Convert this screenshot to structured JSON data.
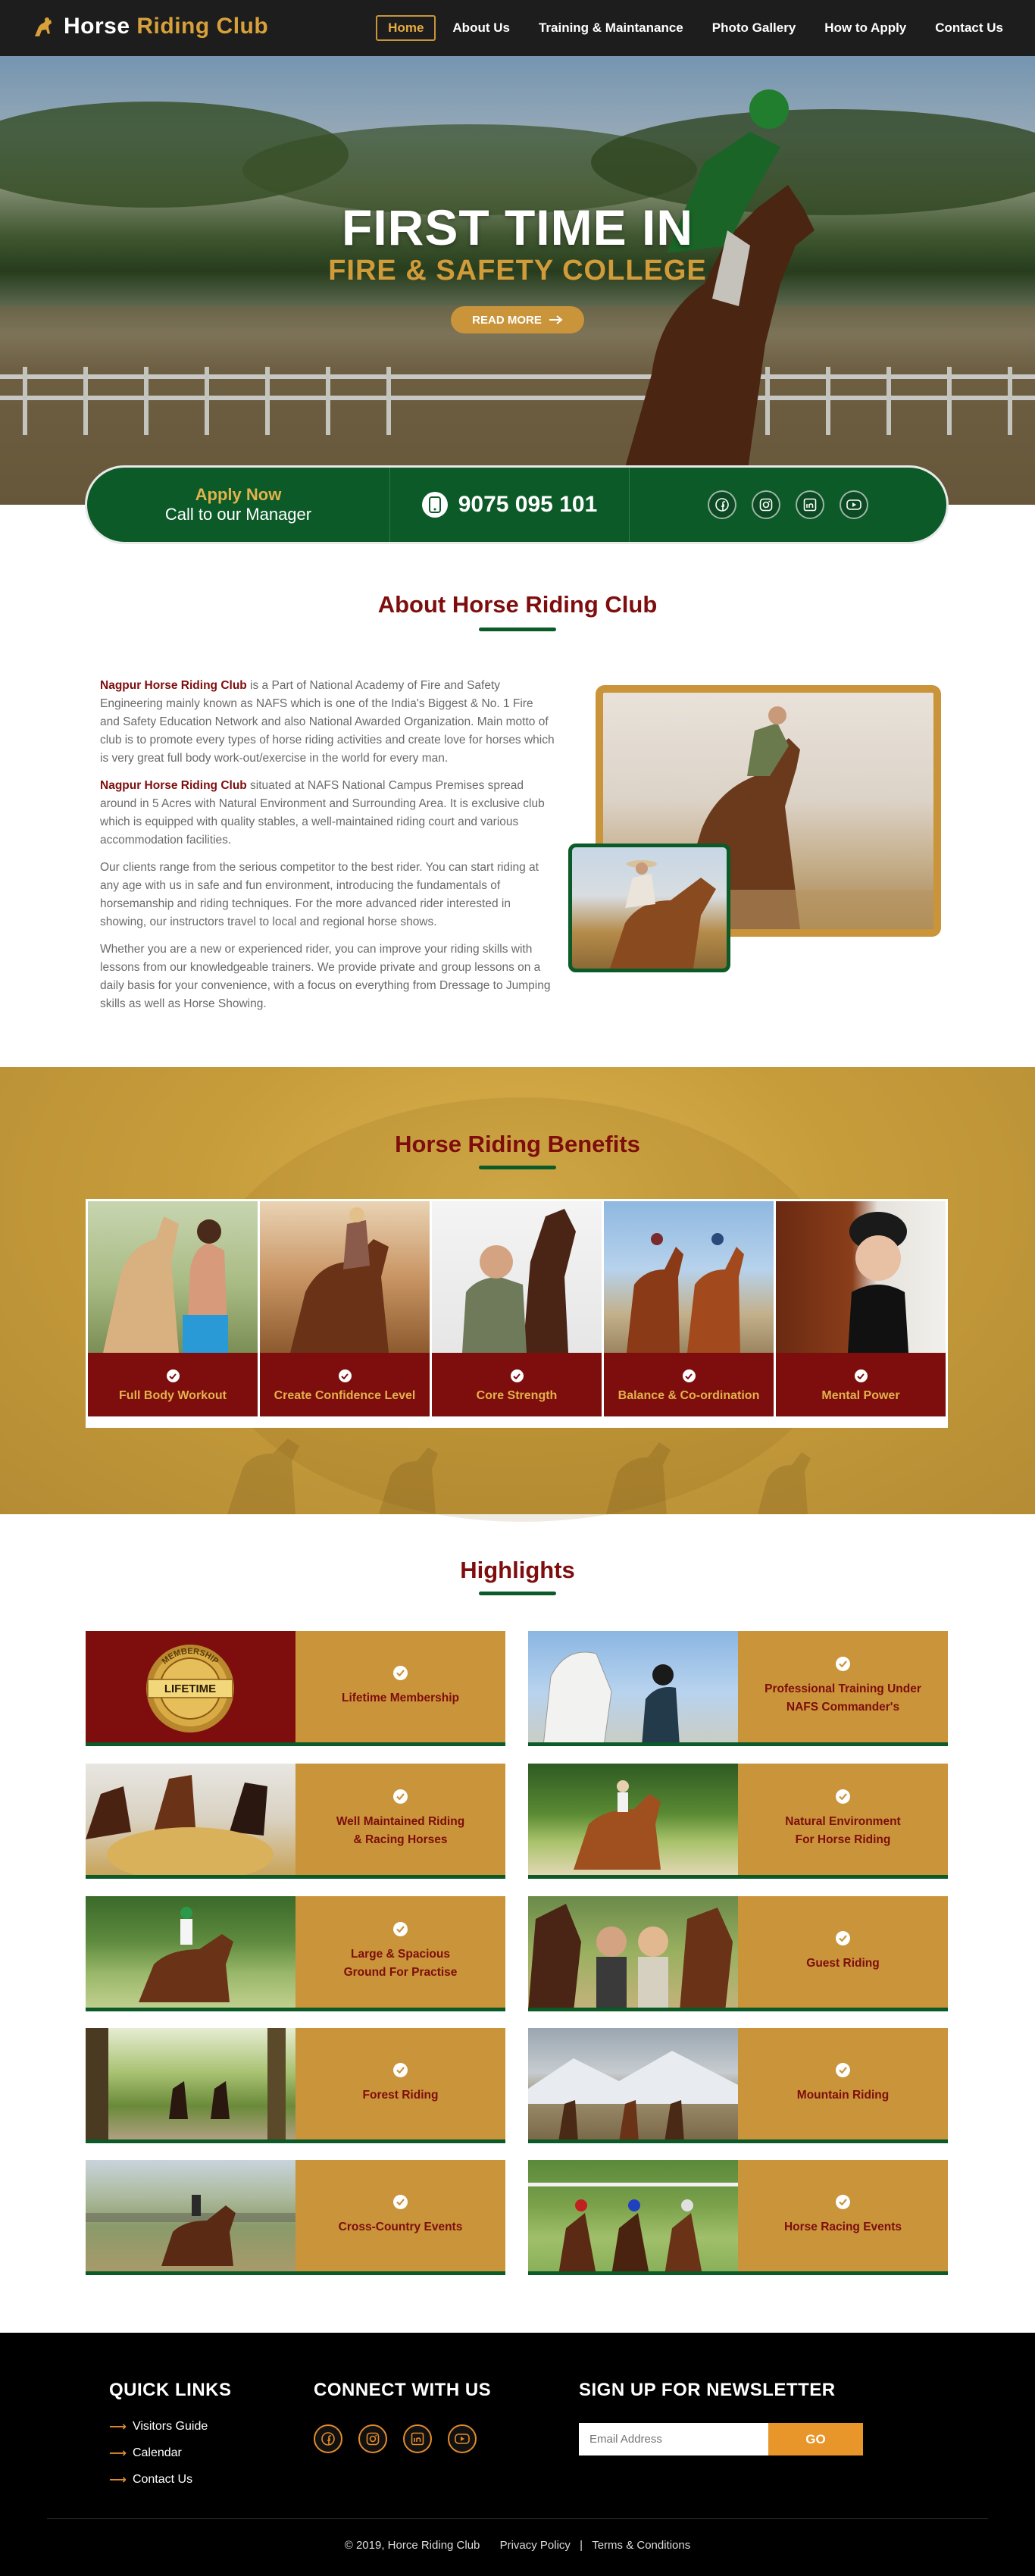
{
  "header": {
    "logo_main": "Horse",
    "logo_accent": "Riding Club",
    "nav": [
      {
        "label": "Home",
        "active": true
      },
      {
        "label": "About Us",
        "active": false
      },
      {
        "label": "Training & Maintanance",
        "active": false
      },
      {
        "label": "Photo Gallery",
        "active": false
      },
      {
        "label": "How to Apply",
        "active": false
      },
      {
        "label": "Contact Us",
        "active": false
      }
    ]
  },
  "hero": {
    "title": "FIRST TIME IN",
    "subtitle": "FIRE & SAFETY COLLEGE",
    "button_label": "READ MORE"
  },
  "contact_bar": {
    "apply_label": "Apply Now",
    "call_label": "Call to our Manager",
    "phone": "9075 095 101",
    "social_icons": [
      "facebook-icon",
      "instagram-icon",
      "linkedin-icon",
      "youtube-icon"
    ]
  },
  "about": {
    "title": "About Horse Riding Club",
    "p1_strong": "Nagpur Horse Riding Club",
    "p1_text": " is a Part of National Academy of Fire and Safety Engineering mainly known as NAFS which is one of the India's Biggest & No. 1 Fire and Safety Education Network and also National Awarded Organization. Main motto of club is to promote every types of horse riding activities and create love for horses which is very great full body work-out/exercise in the world for every man.",
    "p2_strong": "Nagpur Horse Riding Club",
    "p2_text": " situated at NAFS National Campus Premises spread around in 5 Acres with Natural Environment and Surrounding Area.  It is exclusive club which is equipped with quality stables, a well-maintained riding court and various accommodation facilities.",
    "p3": "Our clients range from the serious competitor to the best rider. You can start riding at any age with us in safe and fun environment, introducing the fundamentals of horsemanship and riding techniques. For the more advanced rider interested in showing, our instructors travel to local and regional horse shows.",
    "p4": "Whether you are a new or experienced rider, you can improve your riding skills with lessons from our knowledgeable trainers. We provide private and group lessons on a daily basis for your convenience, with a focus on everything from Dressage to Jumping skills as well as Horse Showing."
  },
  "benefits": {
    "title": "Horse Riding Benefits",
    "items": [
      {
        "label": "Full Body Workout"
      },
      {
        "label": "Create Confidence Level"
      },
      {
        "label": "Core Strength"
      },
      {
        "label": "Balance & Co-ordination"
      },
      {
        "label": "Mental Power"
      }
    ]
  },
  "highlights": {
    "title": "Highlights",
    "badge_text": "LIFETIME",
    "badge_ring": "MEMBERSHIP",
    "items": [
      {
        "line1": "Lifetime Membership",
        "line2": ""
      },
      {
        "line1": "Professional Training Under",
        "line2": "NAFS Commander's"
      },
      {
        "line1": "Well Maintained Riding",
        "line2": "& Racing Horses"
      },
      {
        "line1": "Natural Environment",
        "line2": "For Horse Riding"
      },
      {
        "line1": "Large & Spacious",
        "line2": "Ground For Practise"
      },
      {
        "line1": "Guest Riding",
        "line2": ""
      },
      {
        "line1": "Forest Riding",
        "line2": ""
      },
      {
        "line1": "Mountain Riding",
        "line2": ""
      },
      {
        "line1": "Cross-Country Events",
        "line2": ""
      },
      {
        "line1": "Horse Racing Events",
        "line2": ""
      }
    ]
  },
  "footer": {
    "quick_links_title": "QUICK LINKS",
    "quick_links": [
      "Visitors Guide",
      "Calendar",
      "Contact Us"
    ],
    "connect_title": "CONNECT WITH US",
    "newsletter_title": "SIGN UP FOR NEWSLETTER",
    "email_placeholder": "Email Address",
    "go_label": "GO",
    "copyright": "© 2019, Horce Riding Club",
    "privacy": "Privacy Policy",
    "separator": "|",
    "terms": "Terms & Conditions"
  },
  "colors": {
    "maroon": "#7e0d0d",
    "green": "#0b5a28",
    "gold": "#c9943a",
    "orange": "#e8952a"
  }
}
